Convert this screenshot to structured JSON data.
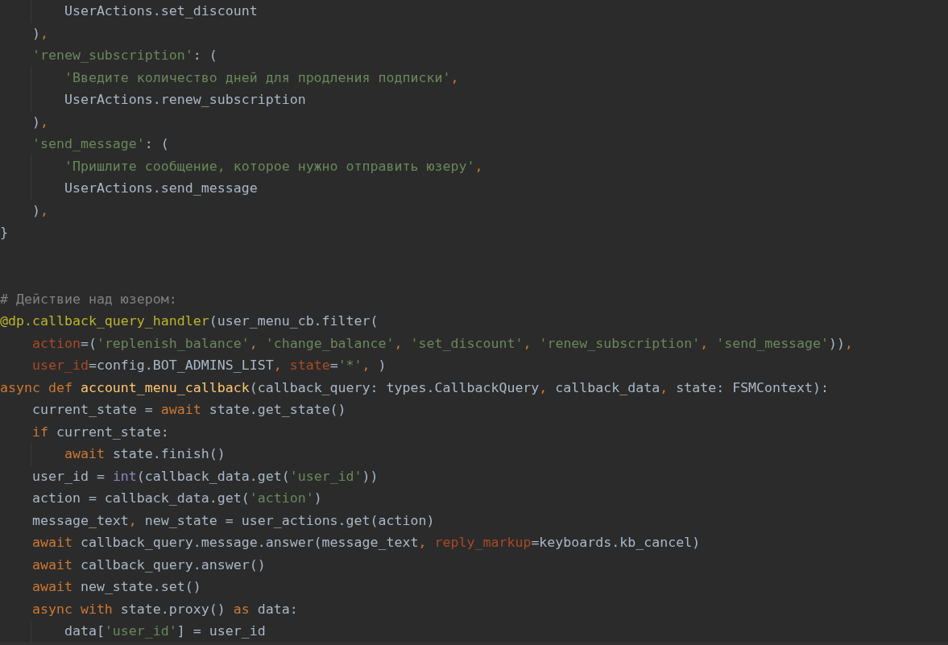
{
  "editor": {
    "lines": [
      {
        "kind": "code",
        "tokens": [
          {
            "kind": "plain",
            "text": "        UserActions.set_discount"
          }
        ]
      },
      {
        "kind": "code",
        "tokens": [
          {
            "kind": "plain",
            "text": "    )"
          },
          {
            "kind": "punc",
            "text": ","
          }
        ]
      },
      {
        "kind": "code",
        "tokens": [
          {
            "kind": "str",
            "text": "    'renew_subscription'"
          },
          {
            "kind": "plain",
            "text": ": ("
          }
        ]
      },
      {
        "kind": "code",
        "tokens": [
          {
            "kind": "str",
            "text": "        'Введите количество дней для продления подписки'"
          },
          {
            "kind": "punc",
            "text": ","
          }
        ]
      },
      {
        "kind": "code",
        "tokens": [
          {
            "kind": "plain",
            "text": "        UserActions.renew_subscription"
          }
        ]
      },
      {
        "kind": "code",
        "tokens": [
          {
            "kind": "plain",
            "text": "    )"
          },
          {
            "kind": "punc",
            "text": ","
          }
        ]
      },
      {
        "kind": "code",
        "tokens": [
          {
            "kind": "str",
            "text": "    'send_message'"
          },
          {
            "kind": "plain",
            "text": ": ("
          }
        ]
      },
      {
        "kind": "code",
        "tokens": [
          {
            "kind": "str",
            "text": "        'Пришлите сообщение, которое нужно отправить юзеру'"
          },
          {
            "kind": "punc",
            "text": ","
          }
        ]
      },
      {
        "kind": "code",
        "tokens": [
          {
            "kind": "plain",
            "text": "        UserActions.send_message"
          }
        ]
      },
      {
        "kind": "code",
        "tokens": [
          {
            "kind": "plain",
            "text": "    )"
          },
          {
            "kind": "punc",
            "text": ","
          }
        ]
      },
      {
        "kind": "code",
        "tokens": [
          {
            "kind": "plain",
            "text": "}"
          }
        ]
      },
      {
        "kind": "blank"
      },
      {
        "kind": "blank"
      },
      {
        "kind": "code",
        "tokens": [
          {
            "kind": "cmt",
            "text": "# Действие над юзером:"
          }
        ]
      },
      {
        "kind": "code",
        "tokens": [
          {
            "kind": "deco",
            "text": "@dp.callback_query_handler"
          },
          {
            "kind": "plain",
            "text": "(user_menu_cb.filter("
          }
        ]
      },
      {
        "kind": "code",
        "tokens": [
          {
            "kind": "param",
            "text": "    action"
          },
          {
            "kind": "plain",
            "text": "=("
          },
          {
            "kind": "str",
            "text": "'replenish_balance'"
          },
          {
            "kind": "punc",
            "text": ", "
          },
          {
            "kind": "str",
            "text": "'change_balance'"
          },
          {
            "kind": "punc",
            "text": ", "
          },
          {
            "kind": "str",
            "text": "'set_discount'"
          },
          {
            "kind": "punc",
            "text": ", "
          },
          {
            "kind": "str",
            "text": "'renew_subscription'"
          },
          {
            "kind": "punc",
            "text": ", "
          },
          {
            "kind": "str",
            "text": "'send_message'"
          },
          {
            "kind": "plain",
            "text": "))"
          },
          {
            "kind": "punc",
            "text": ","
          }
        ]
      },
      {
        "kind": "code",
        "tokens": [
          {
            "kind": "param",
            "text": "    user_id"
          },
          {
            "kind": "plain",
            "text": "=config.BOT_ADMINS_LIST"
          },
          {
            "kind": "punc",
            "text": ", "
          },
          {
            "kind": "param",
            "text": "state"
          },
          {
            "kind": "plain",
            "text": "="
          },
          {
            "kind": "str",
            "text": "'*'"
          },
          {
            "kind": "punc",
            "text": ", "
          },
          {
            "kind": "plain",
            "text": ")"
          }
        ]
      },
      {
        "kind": "code",
        "tokens": [
          {
            "kind": "kw",
            "text": "async def "
          },
          {
            "kind": "fn",
            "text": "account_menu_callback"
          },
          {
            "kind": "plain",
            "text": "(callback_query: types.CallbackQuery"
          },
          {
            "kind": "punc",
            "text": ", "
          },
          {
            "kind": "plain",
            "text": "callback_data"
          },
          {
            "kind": "punc",
            "text": ", "
          },
          {
            "kind": "plain",
            "text": "state: FSMContext):"
          }
        ]
      },
      {
        "kind": "code",
        "tokens": [
          {
            "kind": "plain",
            "text": "    current_state = "
          },
          {
            "kind": "kw",
            "text": "await "
          },
          {
            "kind": "plain",
            "text": "state.get_state()"
          }
        ]
      },
      {
        "kind": "code",
        "tokens": [
          {
            "kind": "kw",
            "text": "    if "
          },
          {
            "kind": "plain",
            "text": "current_state:"
          }
        ]
      },
      {
        "kind": "code",
        "tokens": [
          {
            "kind": "kw",
            "text": "        await "
          },
          {
            "kind": "plain",
            "text": "state.finish()"
          }
        ]
      },
      {
        "kind": "code",
        "tokens": [
          {
            "kind": "plain",
            "text": "    user_id = "
          },
          {
            "kind": "builtin",
            "text": "int"
          },
          {
            "kind": "plain",
            "text": "(callback_data.get("
          },
          {
            "kind": "str",
            "text": "'user_id'"
          },
          {
            "kind": "plain",
            "text": "))"
          }
        ]
      },
      {
        "kind": "code",
        "tokens": [
          {
            "kind": "plain",
            "text": "    action = callback_data.get("
          },
          {
            "kind": "str",
            "text": "'action'"
          },
          {
            "kind": "plain",
            "text": ")"
          }
        ]
      },
      {
        "kind": "code",
        "tokens": [
          {
            "kind": "plain",
            "text": "    message_text"
          },
          {
            "kind": "punc",
            "text": ", "
          },
          {
            "kind": "plain",
            "text": "new_state = user_actions.get(action)"
          }
        ]
      },
      {
        "kind": "code",
        "tokens": [
          {
            "kind": "kw",
            "text": "    await "
          },
          {
            "kind": "plain",
            "text": "callback_query.message.answer(message_text"
          },
          {
            "kind": "punc",
            "text": ", "
          },
          {
            "kind": "param",
            "text": "reply_markup"
          },
          {
            "kind": "plain",
            "text": "=keyboards.kb_cancel)"
          }
        ]
      },
      {
        "kind": "code",
        "tokens": [
          {
            "kind": "kw",
            "text": "    await "
          },
          {
            "kind": "plain",
            "text": "callback_query.answer()"
          }
        ]
      },
      {
        "kind": "code",
        "tokens": [
          {
            "kind": "kw",
            "text": "    await "
          },
          {
            "kind": "plain",
            "text": "new_state.set()"
          }
        ]
      },
      {
        "kind": "code",
        "tokens": [
          {
            "kind": "kw",
            "text": "    async with "
          },
          {
            "kind": "plain",
            "text": "state.proxy() "
          },
          {
            "kind": "kw",
            "text": "as "
          },
          {
            "kind": "plain",
            "text": "data:"
          }
        ]
      },
      {
        "kind": "code",
        "tokens": [
          {
            "kind": "plain",
            "text": "        data["
          },
          {
            "kind": "str",
            "text": "'user_id'"
          },
          {
            "kind": "plain",
            "text": "] = user_id"
          }
        ]
      }
    ]
  }
}
